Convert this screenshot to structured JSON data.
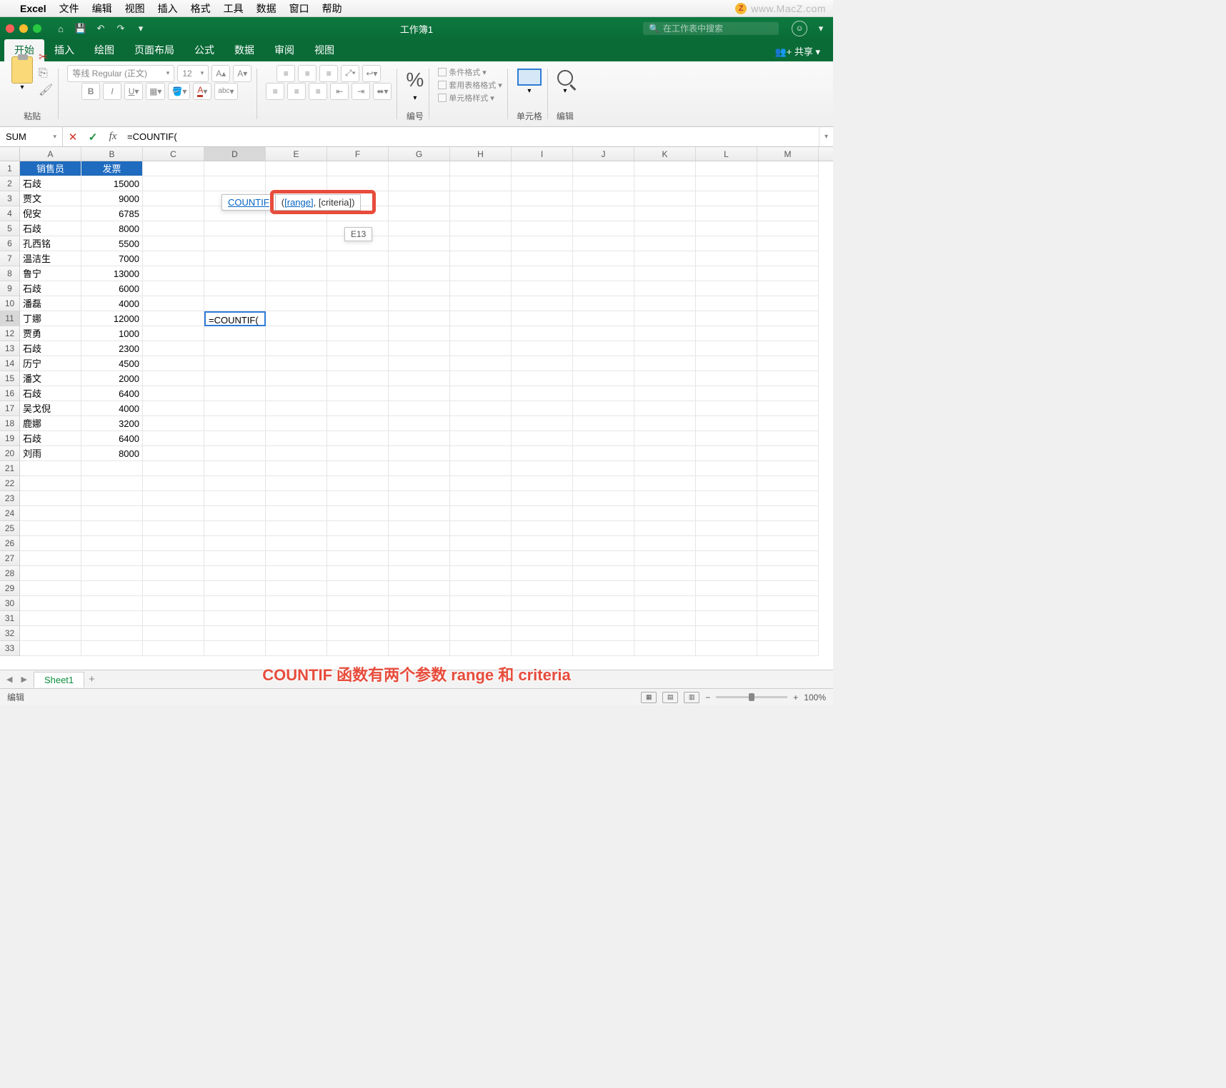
{
  "mac_menu": {
    "app": "Excel",
    "items": [
      "文件",
      "编辑",
      "视图",
      "插入",
      "格式",
      "工具",
      "数据",
      "窗口",
      "帮助"
    ],
    "watermark": "www.MacZ.com"
  },
  "titlebar": {
    "title": "工作簿1",
    "search_placeholder": "在工作表中搜索"
  },
  "ribbon_tabs": {
    "items": [
      "开始",
      "插入",
      "绘图",
      "页面布局",
      "公式",
      "数据",
      "审阅",
      "视图"
    ],
    "active": 0,
    "share": "共享"
  },
  "ribbon": {
    "paste": "粘贴",
    "font_name": "等线 Regular (正文)",
    "font_size": "12",
    "number_label": "编号",
    "cond_format": "条件格式",
    "table_format": "套用表格格式",
    "cell_style": "单元格样式",
    "cells_label": "单元格",
    "edit_label": "编辑"
  },
  "formula_bar": {
    "name_box": "SUM",
    "formula": "=COUNTIF("
  },
  "columns": [
    "A",
    "B",
    "C",
    "D",
    "E",
    "F",
    "G",
    "H",
    "I",
    "J",
    "K",
    "L",
    "M"
  ],
  "active_col": 3,
  "rows_count": 33,
  "active_row": 11,
  "headers": {
    "a": "销售员",
    "b": "发票"
  },
  "data": [
    {
      "a": "石歧",
      "b": "15000"
    },
    {
      "a": "贾文",
      "b": "9000"
    },
    {
      "a": "倪安",
      "b": "6785"
    },
    {
      "a": "石歧",
      "b": "8000"
    },
    {
      "a": "孔西铭",
      "b": "5500"
    },
    {
      "a": "温洁生",
      "b": "7000"
    },
    {
      "a": "鲁宁",
      "b": "13000"
    },
    {
      "a": "石歧",
      "b": "6000"
    },
    {
      "a": "潘磊",
      "b": "4000"
    },
    {
      "a": "丁娜",
      "b": "12000"
    },
    {
      "a": "贾勇",
      "b": "1000"
    },
    {
      "a": "石歧",
      "b": "2300"
    },
    {
      "a": "历宁",
      "b": "4500"
    },
    {
      "a": "潘文",
      "b": "2000"
    },
    {
      "a": "石歧",
      "b": "6400"
    },
    {
      "a": "吴戈倪",
      "b": "4000"
    },
    {
      "a": "鹿娜",
      "b": "3200"
    },
    {
      "a": "石歧",
      "b": "6400"
    },
    {
      "a": "刘雨",
      "b": "8000"
    }
  ],
  "editing_cell": {
    "value": "=COUNTIF("
  },
  "tooltip": {
    "func": "COUNTIF",
    "arg_current": "[range]",
    "arg_rest": ", [criteria])"
  },
  "cell_ref_tip": "E13",
  "sheet": {
    "name": "Sheet1"
  },
  "status": {
    "mode": "编辑",
    "zoom": "100%"
  },
  "caption": "COUNTIF 函数有两个参数 range 和 criteria"
}
